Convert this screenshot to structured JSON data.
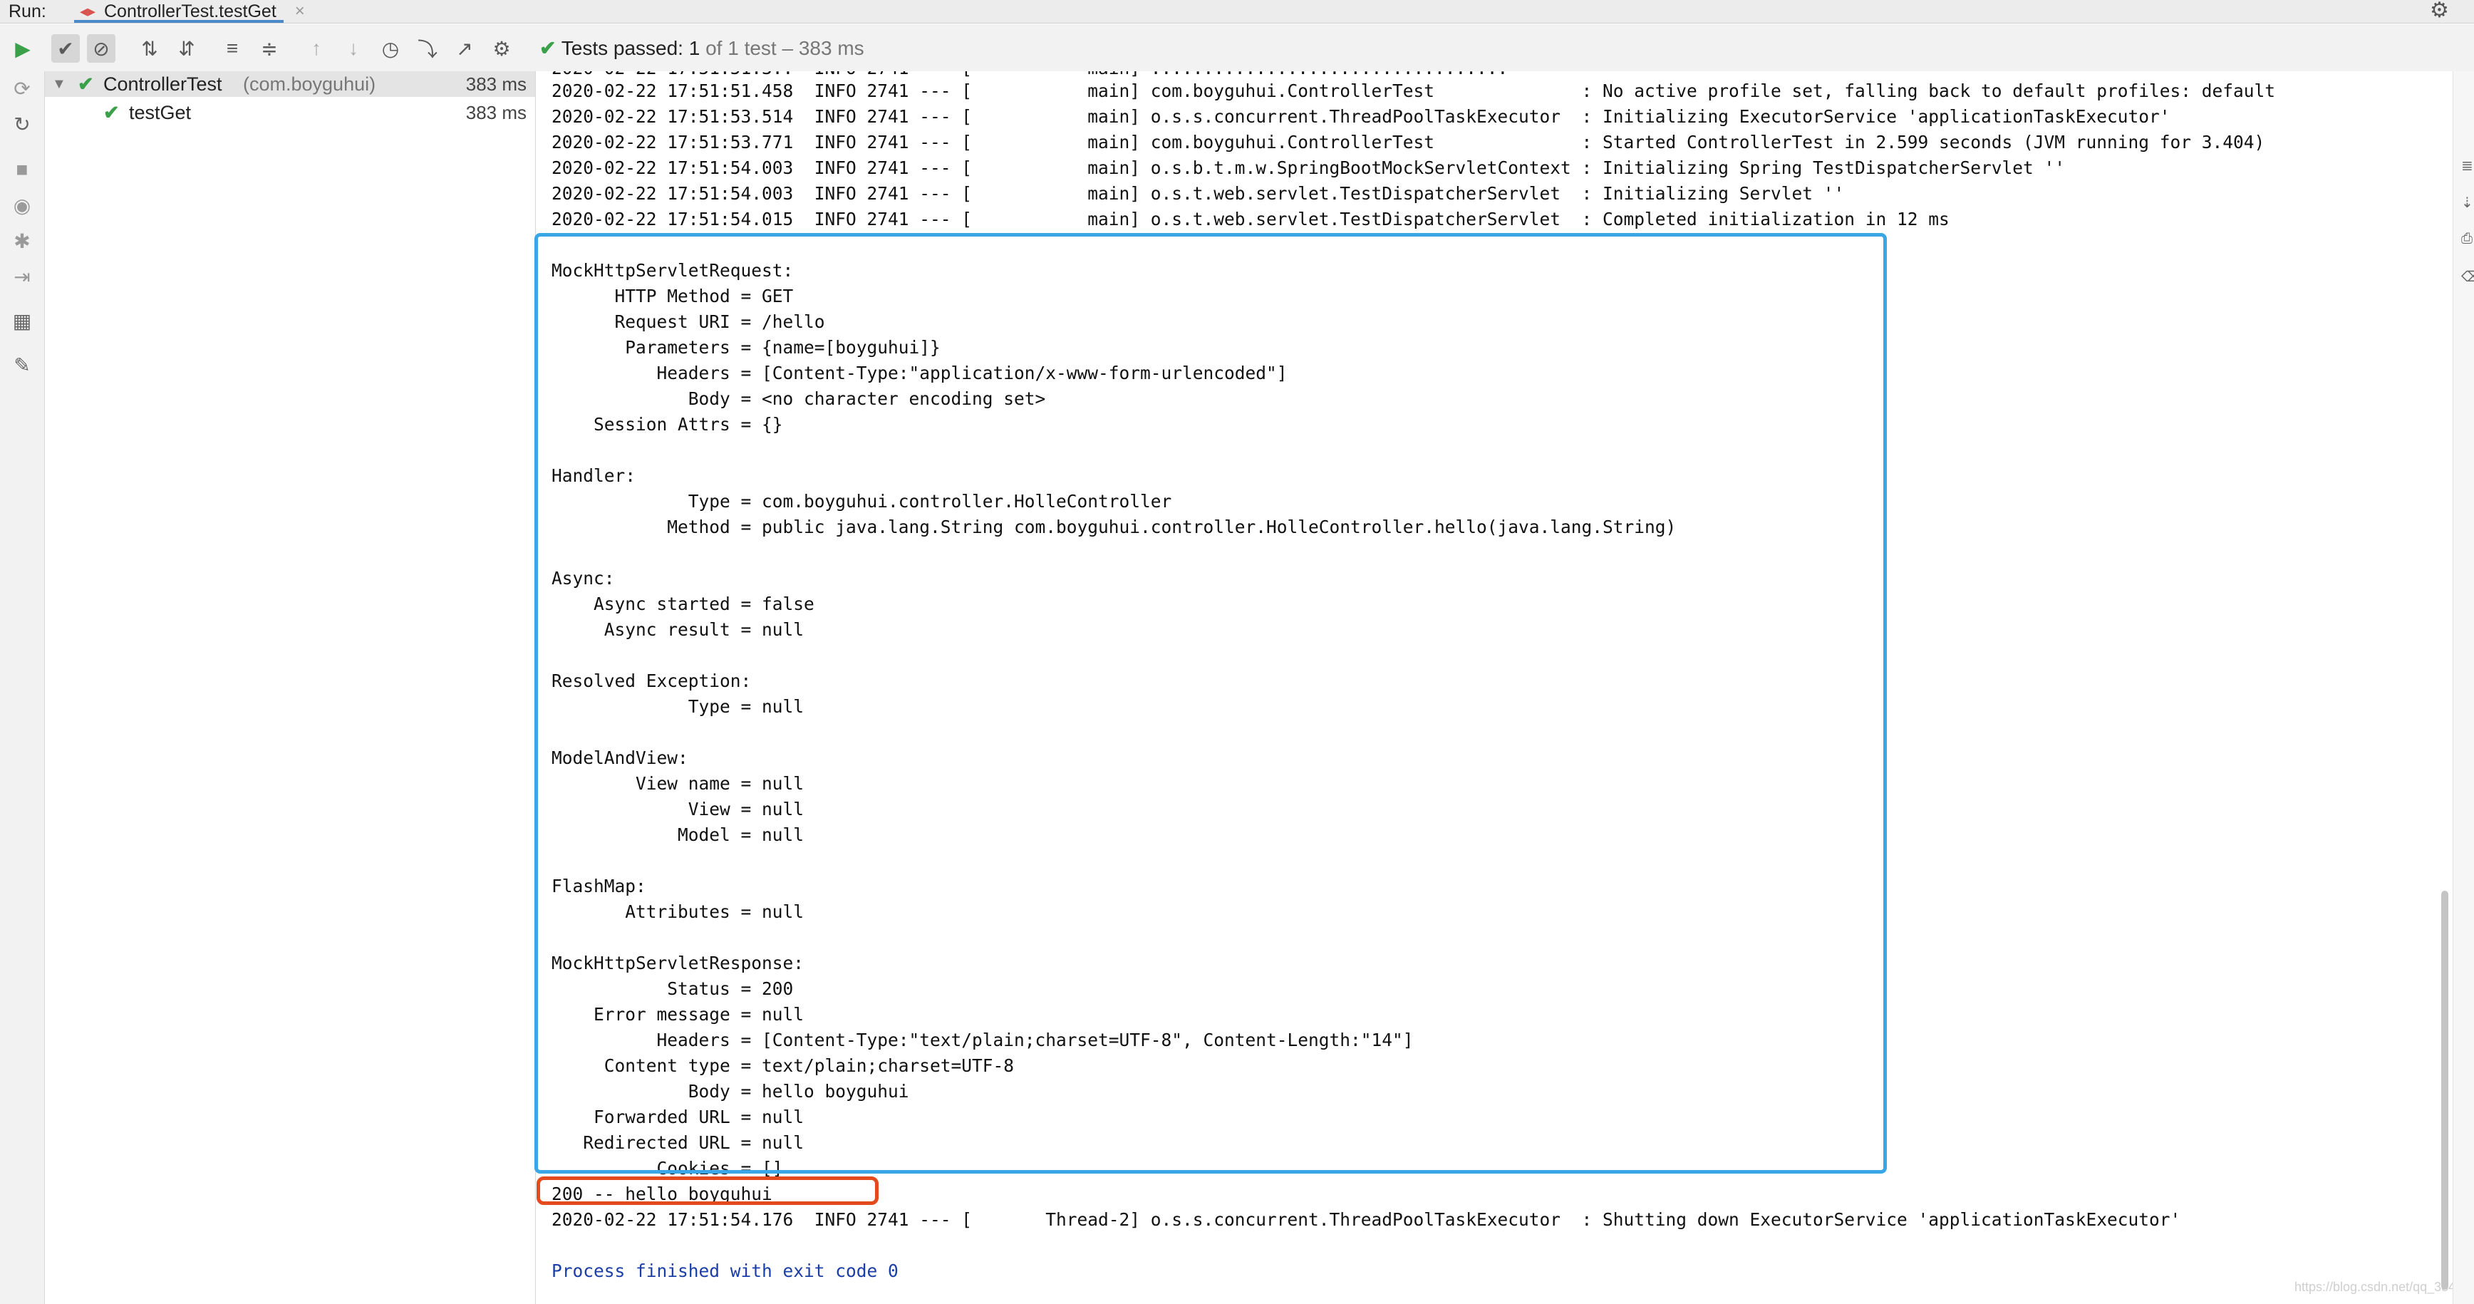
{
  "titlebar": {
    "run_label": "Run:",
    "tab_label": "ControllerTest.testGet",
    "tab_close": "×"
  },
  "toolbar": {
    "status_prefix": "Tests passed:",
    "status_count": "1",
    "status_rest": "of 1 test – 383 ms"
  },
  "tree": {
    "root_name": "ControllerTest",
    "root_pkg": "(com.boyguhui)",
    "root_time": "383 ms",
    "child_name": "testGet",
    "child_time": "383 ms"
  },
  "console_lines": [
    "2020-02-22 17:51:51.458  INFO 2741 --- [           main] com.boyguhui.ControllerTest              : No active profile set, falling back to default profiles: default",
    "2020-02-22 17:51:53.514  INFO 2741 --- [           main] o.s.s.concurrent.ThreadPoolTaskExecutor  : Initializing ExecutorService 'applicationTaskExecutor'",
    "2020-02-22 17:51:53.771  INFO 2741 --- [           main] com.boyguhui.ControllerTest              : Started ControllerTest in 2.599 seconds (JVM running for 3.404)",
    "2020-02-22 17:51:54.003  INFO 2741 --- [           main] o.s.b.t.m.w.SpringBootMockServletContext : Initializing Spring TestDispatcherServlet ''",
    "2020-02-22 17:51:54.003  INFO 2741 --- [           main] o.s.t.web.servlet.TestDispatcherServlet  : Initializing Servlet ''",
    "2020-02-22 17:51:54.015  INFO 2741 --- [           main] o.s.t.web.servlet.TestDispatcherServlet  : Completed initialization in 12 ms",
    "",
    "MockHttpServletRequest:",
    "      HTTP Method = GET",
    "      Request URI = /hello",
    "       Parameters = {name=[boyguhui]}",
    "          Headers = [Content-Type:\"application/x-www-form-urlencoded\"]",
    "             Body = <no character encoding set>",
    "    Session Attrs = {}",
    "",
    "Handler:",
    "             Type = com.boyguhui.controller.HolleController",
    "           Method = public java.lang.String com.boyguhui.controller.HolleController.hello(java.lang.String)",
    "",
    "Async:",
    "    Async started = false",
    "     Async result = null",
    "",
    "Resolved Exception:",
    "             Type = null",
    "",
    "ModelAndView:",
    "        View name = null",
    "             View = null",
    "            Model = null",
    "",
    "FlashMap:",
    "       Attributes = null",
    "",
    "MockHttpServletResponse:",
    "           Status = 200",
    "    Error message = null",
    "          Headers = [Content-Type:\"text/plain;charset=UTF-8\", Content-Length:\"14\"]",
    "     Content type = text/plain;charset=UTF-8",
    "             Body = hello boyguhui",
    "    Forwarded URL = null",
    "   Redirected URL = null",
    "          Cookies = []",
    "200 -- hello boyguhui",
    "2020-02-22 17:51:54.176  INFO 2741 --- [       Thread-2] o.s.s.concurrent.ThreadPoolTaskExecutor  : Shutting down ExecutorService 'applicationTaskExecutor'",
    "",
    "Process finished with exit code 0"
  ],
  "watermark": "https://blog.csdn.net/qq_384..."
}
